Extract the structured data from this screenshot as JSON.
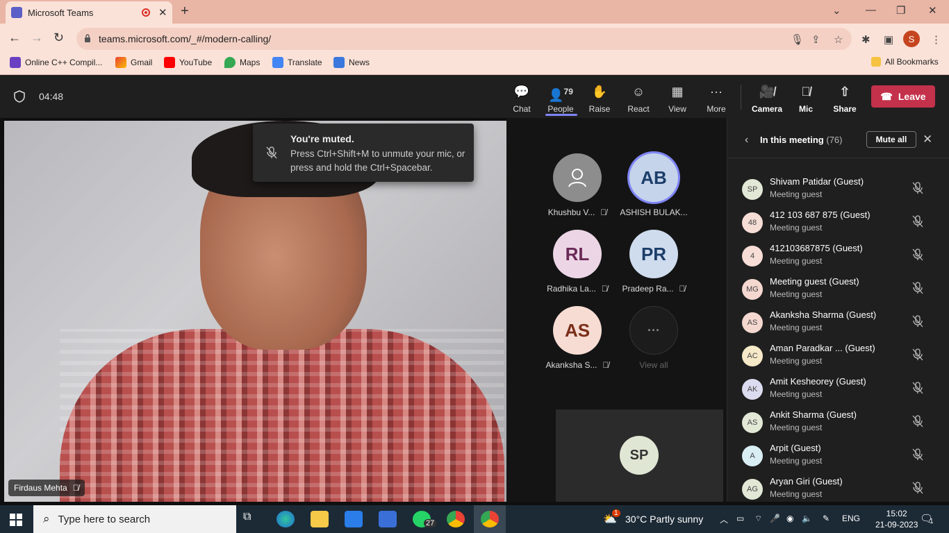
{
  "browser": {
    "tab_title": "Microsoft Teams",
    "url": "teams.microsoft.com/_#/modern-calling/",
    "profile_initial": "S",
    "bookmarks": [
      "Online C++ Compil...",
      "Gmail",
      "YouTube",
      "Maps",
      "Translate",
      "News"
    ],
    "all_bookmarks": "All Bookmarks"
  },
  "meeting": {
    "timer": "04:48",
    "toolbar": {
      "chat": "Chat",
      "people": "People",
      "people_count": "79",
      "raise": "Raise",
      "react": "React",
      "view": "View",
      "more": "More",
      "camera": "Camera",
      "mic": "Mic",
      "share": "Share",
      "leave": "Leave"
    },
    "toast": {
      "title": "You're muted.",
      "body": "Press Ctrl+Shift+M to unmute your mic, or press and hold the Ctrl+Spacebar."
    },
    "main_video_name": "Firdaus Mehta",
    "gallery": [
      {
        "initials": "",
        "name": "Khushbu V..."
      },
      {
        "initials": "AB",
        "name": "ASHISH BULAK..."
      },
      {
        "initials": "RL",
        "name": "Radhika La..."
      },
      {
        "initials": "PR",
        "name": "Pradeep Ra..."
      },
      {
        "initials": "AS",
        "name": "Akanksha S..."
      },
      {
        "initials": "···",
        "name": "View all"
      }
    ],
    "self_tile_initials": "SP"
  },
  "panel": {
    "title": "In this meeting",
    "count": "(76)",
    "mute_all": "Mute all",
    "participants": [
      {
        "initials": "SP",
        "name": "Shivam Patidar (Guest)",
        "role": "Meeting guest",
        "color": "#e1e8d6"
      },
      {
        "initials": "48",
        "name": "412 103 687 875 (Guest)",
        "role": "Meeting guest",
        "color": "#f6ddd5"
      },
      {
        "initials": "4",
        "name": "412103687875 (Guest)",
        "role": "Meeting guest",
        "color": "#f6ddd5"
      },
      {
        "initials": "MG",
        "name": "Meeting guest (Guest)",
        "role": "Meeting guest",
        "color": "#f4d7cf"
      },
      {
        "initials": "AS",
        "name": "Akanksha Sharma (Guest)",
        "role": "Meeting guest",
        "color": "#f4d7cf"
      },
      {
        "initials": "AC",
        "name": "Aman Paradkar ...    (Guest)",
        "role": "Meeting guest",
        "color": "#f6e9c8"
      },
      {
        "initials": "AK",
        "name": "Amit Kesheorey (Guest)",
        "role": "Meeting guest",
        "color": "#dcdcf0"
      },
      {
        "initials": "AS",
        "name": "Ankit Sharma (Guest)",
        "role": "Meeting guest",
        "color": "#e1e8d6"
      },
      {
        "initials": "A",
        "name": "Arpit (Guest)",
        "role": "Meeting guest",
        "color": "#d8eef3"
      },
      {
        "initials": "AG",
        "name": "Aryan Giri (Guest)",
        "role": "Meeting guest",
        "color": "#e1e8d6"
      }
    ]
  },
  "taskbar": {
    "search_placeholder": "Type here to search",
    "whatsapp_badge": "27",
    "weather": "30°C  Partly sunny",
    "weather_badge": "1",
    "lang": "ENG",
    "time": "15:02",
    "date": "21-09-2023",
    "notif": "1"
  }
}
